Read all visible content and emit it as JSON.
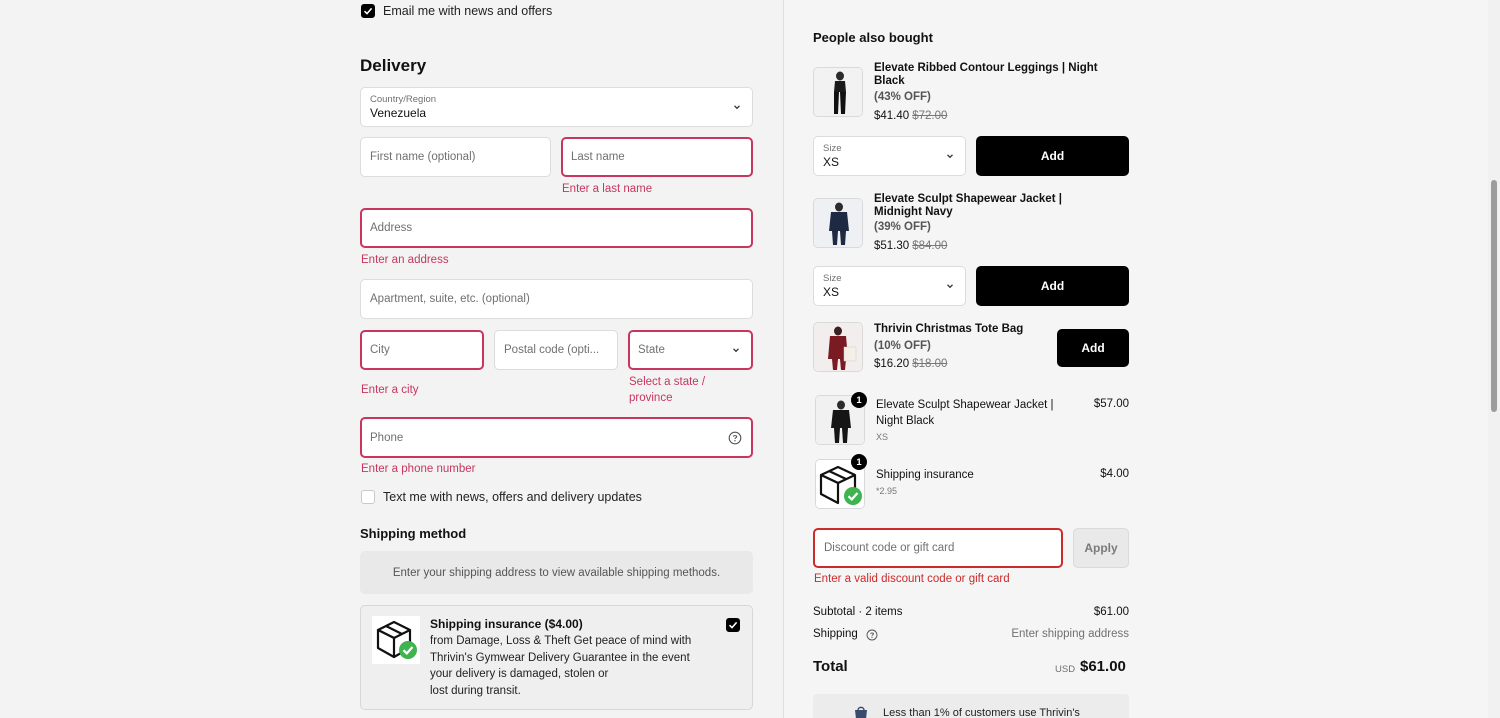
{
  "contact": {
    "email_opt_in_label": "Email me with news and offers",
    "email_opt_in_checked": true
  },
  "delivery": {
    "heading": "Delivery",
    "country_label": "Country/Region",
    "country_value": "Venezuela",
    "first_name_placeholder": "First name (optional)",
    "last_name_placeholder": "Last name",
    "last_name_error": "Enter a last name",
    "address_placeholder": "Address",
    "address_error": "Enter an address",
    "apartment_placeholder": "Apartment, suite, etc. (optional)",
    "city_placeholder": "City",
    "city_error": "Enter a city",
    "postal_placeholder": "Postal code (opti...",
    "state_placeholder": "State",
    "state_error_line1": "Select a state /",
    "state_error_line2": "province",
    "phone_placeholder": "Phone",
    "phone_error": "Enter a phone number",
    "sms_opt_in_label": "Text me with news, offers and delivery updates",
    "sms_opt_in_checked": false
  },
  "shipping_method": {
    "heading": "Shipping method",
    "placeholder_text": "Enter your shipping address to view available shipping methods.",
    "insurance_title": "Shipping insurance ($4.00)",
    "insurance_desc_line1": "from Damage, Loss & Theft Get peace of mind with",
    "insurance_desc_line2": "Thrivin's Gymwear Delivery Guarantee in the event",
    "insurance_desc_line3": "your delivery is damaged, stolen or",
    "insurance_desc_line4": "lost during transit.",
    "insurance_checked": true
  },
  "upsell": {
    "heading": "People also bought",
    "items": [
      {
        "name_line1": "Elevate Ribbed Contour Leggings | Night",
        "name_line2": "Black",
        "discount": "(43% OFF)",
        "price": "$41.40",
        "compare_price": "$72.00",
        "size_label": "Size",
        "size_value": "XS",
        "add_label": "Add"
      },
      {
        "name_line1": "Elevate Sculpt Shapewear Jacket |",
        "name_line2": "Midnight Navy",
        "discount": "(39% OFF)",
        "price": "$51.30",
        "compare_price": "$84.00",
        "size_label": "Size",
        "size_value": "XS",
        "add_label": "Add"
      },
      {
        "name_line1": "Thrivin Christmas Tote Bag",
        "discount": "(10% OFF)",
        "price": "$16.20",
        "compare_price": "$18.00",
        "add_label": "Add"
      }
    ]
  },
  "cart": {
    "items": [
      {
        "quantity": "1",
        "name_line1": "Elevate Sculpt Shapewear Jacket |",
        "name_line2": "Night Black",
        "variant": "XS",
        "price": "$57.00"
      },
      {
        "quantity": "1",
        "name_line1": "Shipping insurance",
        "variant": "*2.95",
        "price": "$4.00"
      }
    ]
  },
  "discount": {
    "placeholder": "Discount code or gift card",
    "apply_label": "Apply",
    "error": "Enter a valid discount code or gift card"
  },
  "summary": {
    "subtotal_label": "Subtotal · 2 items",
    "subtotal_value": "$61.00",
    "shipping_label": "Shipping",
    "shipping_value": "Enter shipping address",
    "total_label": "Total",
    "currency": "USD",
    "total_value": "$61.00",
    "promo_text": "Less than 1% of customers use Thrivin's"
  },
  "colors": {
    "error": "#c7365f",
    "discount_error": "#cc2b2b",
    "button": "#000000"
  }
}
